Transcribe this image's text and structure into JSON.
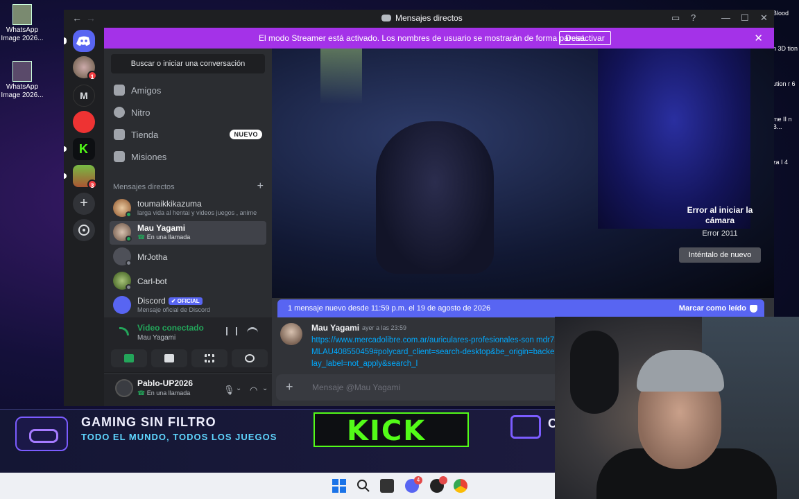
{
  "desktop": {
    "icons": [
      {
        "label": "WhatsApp Image 2026..."
      },
      {
        "label": "WhatsApp Image 2026..."
      }
    ],
    "right_edge_labels": [
      "Blood",
      "n 3D tion",
      "ution r 6",
      "me II n B...",
      "za I 4"
    ]
  },
  "promo": {
    "title": "GAMING SIN FILTRO",
    "subtitle": "TODO EL MUNDO, TODOS LOS JUEGOS",
    "kick": "KICK",
    "cut": "C"
  },
  "window": {
    "title": "Mensajes directos",
    "back": "←",
    "forward": "→"
  },
  "banner": {
    "text": "El modo Streamer está activado. Los nombres de usuario se mostrarán de forma parcial.",
    "button": "Desactivar",
    "close": "✕"
  },
  "rail": {
    "servers": [
      {
        "name": "home",
        "badge": ""
      },
      {
        "name": "avatar-server",
        "badge": "1"
      },
      {
        "name": "M",
        "badge": ""
      },
      {
        "name": "red-server",
        "badge": ""
      },
      {
        "name": "kick-server",
        "badge": ""
      },
      {
        "name": "minecraft-server",
        "badge": "3"
      }
    ],
    "letter": "M"
  },
  "sidebar": {
    "search": "Buscar o iniciar una conversación",
    "nav": [
      {
        "label": "Amigos",
        "badge": ""
      },
      {
        "label": "Nitro",
        "badge": ""
      },
      {
        "label": "Tienda",
        "badge": "NUEVO"
      },
      {
        "label": "Misiones",
        "badge": ""
      }
    ],
    "dm_header": "Mensajes directos",
    "dm_add": "+",
    "dms": [
      {
        "name": "toumaikkikazuma",
        "status": "larga vida al hentai y videos juegos , anime"
      },
      {
        "name": "Mau Yagami",
        "status": "En una llamada"
      },
      {
        "name": "MrJotha",
        "status": ""
      },
      {
        "name": "Carl-bot",
        "status": ""
      },
      {
        "name": "Discord",
        "badge": "✔ OFICIAL",
        "status": "Mensaje oficial de Discord"
      }
    ]
  },
  "voice": {
    "state": "Video conectado",
    "channel": "Mau Yagami"
  },
  "user": {
    "name": "Pablo-UP2026",
    "status": "En una llamada"
  },
  "camera_error": {
    "title": "Error al iniciar la cámara",
    "code": "Error 2011",
    "retry": "Inténtalo de nuevo"
  },
  "new_messages": {
    "text": "1 mensaje nuevo desde 11:59 p.m. el 19 de agosto de 2026",
    "mark_read": "Marcar como leído"
  },
  "message": {
    "author": "Mau Yagami",
    "time": "ayer a las 23:59",
    "link": "https://www.mercadolibre.com.ar/auriculares-profesionales-son mdr7506/up/MLAU408550459#polycard_client=search-desktop&be_origin=backend&overlay_label=not_apply&search_l"
  },
  "composer": {
    "plus": "+",
    "placeholder": "Mensaje @Mau Yagami"
  },
  "colors": {
    "accent": "#5865f2",
    "streamer_banner": "#a432e8",
    "online": "#23a55a",
    "link": "#00a8fc",
    "kick_green": "#53fc18"
  }
}
